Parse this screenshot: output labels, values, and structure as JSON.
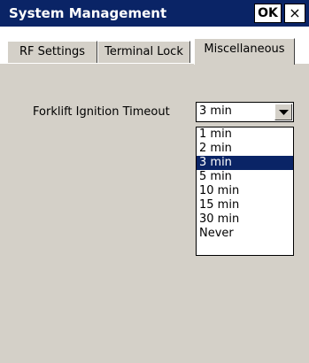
{
  "window": {
    "title": "System Management",
    "ok_label": "OK",
    "close_label": "×"
  },
  "tabs": [
    {
      "label": "RF Settings",
      "active": false
    },
    {
      "label": "Terminal Lock",
      "active": false
    },
    {
      "label": "Miscellaneous",
      "active": true
    }
  ],
  "form": {
    "field_label": "Forklift Ignition Timeout",
    "selected_value": "3 min"
  },
  "dropdown": {
    "options": [
      "1 min",
      "2 min",
      "3 min",
      "5 min",
      "10 min",
      "15 min",
      "30 min",
      "Never"
    ],
    "highlighted_index": 2
  },
  "colors": {
    "titlebar": "#0a2466",
    "selection": "#0a2466",
    "client_background": "#d4d0c8"
  },
  "icons": {
    "combo_arrow": "chevron-down-icon",
    "close": "close-icon"
  }
}
